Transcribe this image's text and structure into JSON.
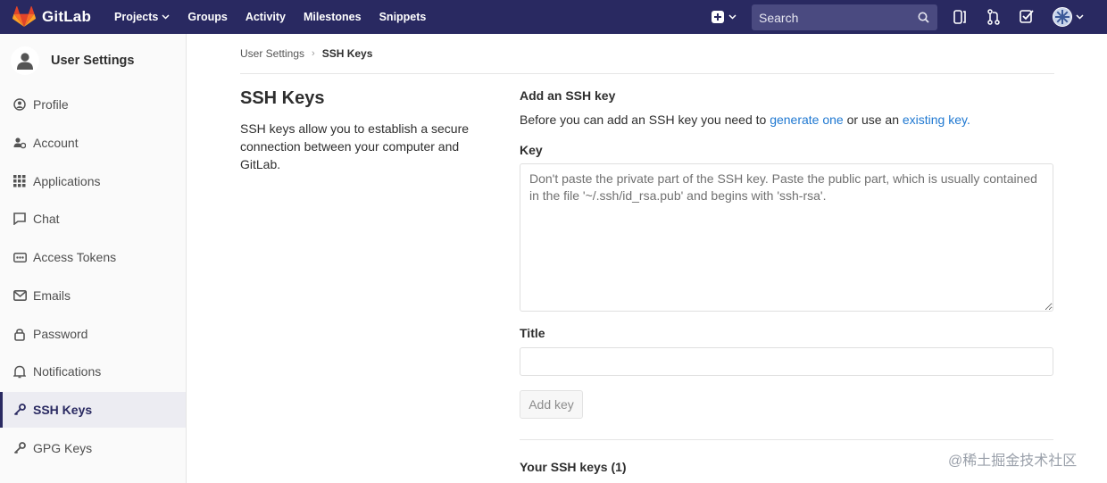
{
  "navbar": {
    "brand": "GitLab",
    "links": [
      "Projects",
      "Groups",
      "Activity",
      "Milestones",
      "Snippets"
    ],
    "search_placeholder": "Search",
    "colors": {
      "bar": "#292961",
      "logo": "#e24329"
    }
  },
  "sidebar": {
    "title": "User Settings",
    "items": [
      {
        "label": "Profile",
        "icon": "profile-icon"
      },
      {
        "label": "Account",
        "icon": "account-icon"
      },
      {
        "label": "Applications",
        "icon": "applications-icon"
      },
      {
        "label": "Chat",
        "icon": "chat-icon"
      },
      {
        "label": "Access Tokens",
        "icon": "token-icon"
      },
      {
        "label": "Emails",
        "icon": "email-icon"
      },
      {
        "label": "Password",
        "icon": "lock-icon"
      },
      {
        "label": "Notifications",
        "icon": "bell-icon"
      },
      {
        "label": "SSH Keys",
        "icon": "key-icon",
        "active": true
      },
      {
        "label": "GPG Keys",
        "icon": "key-icon"
      }
    ]
  },
  "breadcrumb": {
    "parent": "User Settings",
    "current": "SSH Keys"
  },
  "page": {
    "title": "SSH Keys",
    "description": "SSH keys allow you to establish a secure connection between your computer and GitLab."
  },
  "form": {
    "heading": "Add an SSH key",
    "intro_prefix": "Before you can add an SSH key you need to ",
    "link_generate": "generate one",
    "intro_middle": " or use an ",
    "link_existing": "existing key.",
    "key_label": "Key",
    "key_placeholder": "Don't paste the private part of the SSH key. Paste the public part, which is usually contained in the file '~/.ssh/id_rsa.pub' and begins with 'ssh-rsa'.",
    "title_label": "Title",
    "title_value": "",
    "add_button": "Add key",
    "your_keys": "Your SSH keys (1)"
  },
  "watermark": "@稀土掘金技术社区"
}
